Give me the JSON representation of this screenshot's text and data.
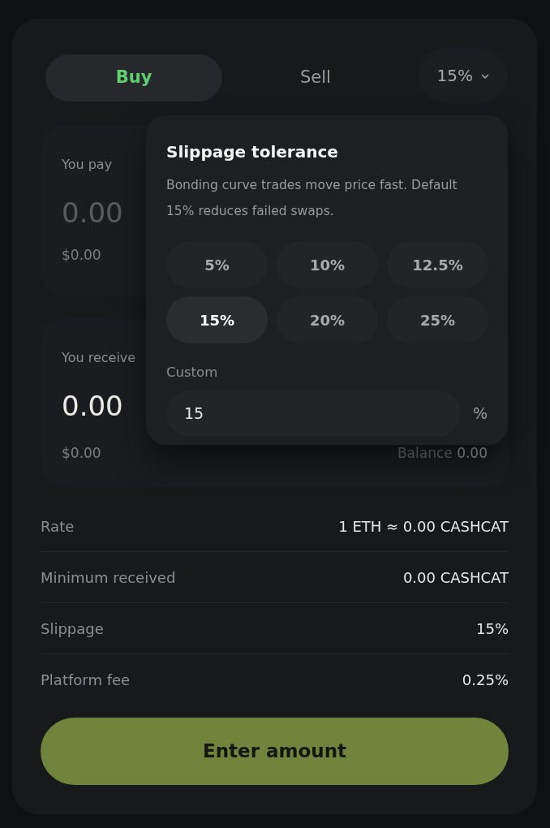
{
  "tabs": [
    {
      "label": "Buy",
      "selected": true
    },
    {
      "label": "Sell",
      "selected": false
    }
  ],
  "slippage_button": {
    "label": "15%",
    "expanded": true
  },
  "pay": {
    "label": "You pay",
    "amount": "0.00",
    "usd": "$0.00",
    "filled": false
  },
  "receive": {
    "label": "You receive",
    "amount": "0.00",
    "usd": "$0.00",
    "filled": true,
    "balance_label": "Balance",
    "balance_value": "0.00"
  },
  "popover": {
    "title": "Slippage tolerance",
    "description": "Bonding curve trades move price fast. Default 15% reduces failed swaps.",
    "options": [
      {
        "label": "5%",
        "selected": false
      },
      {
        "label": "10%",
        "selected": false
      },
      {
        "label": "12.5%",
        "selected": false
      },
      {
        "label": "15%",
        "selected": true
      },
      {
        "label": "20%",
        "selected": false
      },
      {
        "label": "25%",
        "selected": false
      }
    ],
    "custom_label": "Custom",
    "custom_value": "15",
    "custom_unit": "%"
  },
  "details": [
    {
      "label": "Rate",
      "value": "1 ETH ≈ 0.00 CASHCAT"
    },
    {
      "label": "Minimum received",
      "value": "0.00 CASHCAT"
    },
    {
      "label": "Slippage",
      "value": "15%"
    },
    {
      "label": "Platform fee",
      "value": "0.25%"
    }
  ],
  "action_button": {
    "label": "Enter amount"
  }
}
